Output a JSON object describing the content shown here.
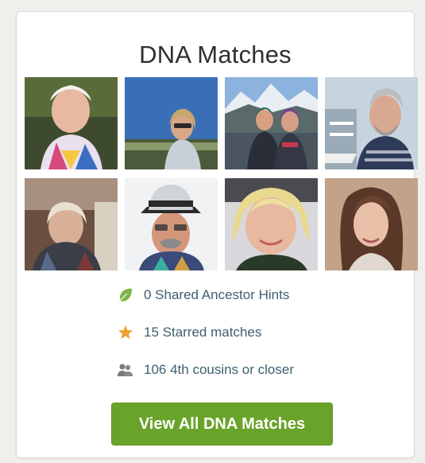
{
  "widget": {
    "title": "DNA Matches"
  },
  "matches": [
    {
      "alt": "match-photo-1"
    },
    {
      "alt": "match-photo-2"
    },
    {
      "alt": "match-photo-3"
    },
    {
      "alt": "match-photo-4"
    },
    {
      "alt": "match-photo-5"
    },
    {
      "alt": "match-photo-6"
    },
    {
      "alt": "match-photo-7"
    },
    {
      "alt": "match-photo-8"
    }
  ],
  "stats": {
    "hints": {
      "icon": "leaf-icon",
      "label": "0 Shared Ancestor Hints"
    },
    "starred": {
      "icon": "star-icon",
      "label": "15 Starred matches"
    },
    "cousins": {
      "icon": "people-icon",
      "label": "106 4th cousins or closer"
    }
  },
  "button": {
    "label": "View All DNA Matches"
  },
  "colors": {
    "accent_green": "#6aa32a",
    "leaf_green": "#7ab648",
    "star_orange": "#f0a030",
    "link_text": "#3f5f6f",
    "title_text": "#2f2f2f"
  }
}
